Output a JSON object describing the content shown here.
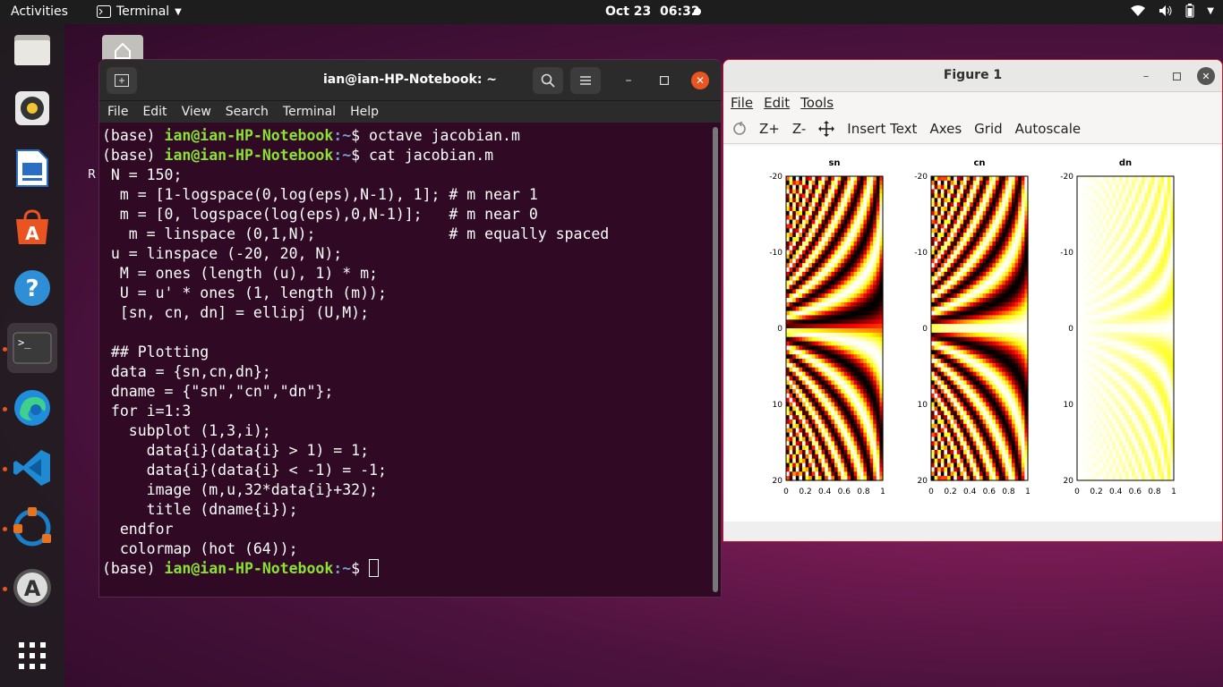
{
  "topbar": {
    "activities": "Activities",
    "app_name": "Terminal",
    "date": "Oct 23",
    "time": "06:32"
  },
  "desktop": {
    "label_fragment": "R"
  },
  "terminal": {
    "title": "ian@ian-HP-Notebook: ~",
    "menu": [
      "File",
      "Edit",
      "View",
      "Search",
      "Terminal",
      "Help"
    ],
    "prompt_env": "(base) ",
    "prompt_user": "ian@ian-HP-Notebook",
    "prompt_path": ":~",
    "prompt_sym": "$ ",
    "cmd1": "octave jacobian.m",
    "cmd2": "cat jacobian.m",
    "script_lines": [
      " N = 150;",
      "  m = [1-logspace(0,log(eps),N-1), 1]; # m near 1",
      "  m = [0, logspace(log(eps),0,N-1)];   # m near 0",
      "   m = linspace (0,1,N);               # m equally spaced",
      " u = linspace (-20, 20, N);",
      "  M = ones (length (u), 1) * m;",
      "  U = u' * ones (1, length (m));",
      "  [sn, cn, dn] = ellipj (U,M);",
      "",
      " ## Plotting",
      " data = {sn,cn,dn};",
      " dname = {\"sn\",\"cn\",\"dn\"};",
      " for i=1:3",
      "   subplot (1,3,i);",
      "     data{i}(data{i} > 1) = 1;",
      "     data{i}(data{i} < -1) = -1;",
      "     image (m,u,32*data{i}+32);",
      "     title (dname{i});",
      "  endfor",
      "  colormap (hot (64));"
    ]
  },
  "figure": {
    "title": "Figure 1",
    "menu": [
      "File",
      "Edit",
      "Tools"
    ],
    "toolbar": [
      "Z+",
      "Z-",
      "Insert Text",
      "Axes",
      "Grid",
      "Autoscale"
    ],
    "plots": [
      "sn",
      "cn",
      "dn"
    ],
    "y_ticks": [
      "-20",
      "-10",
      "0",
      "10",
      "20"
    ],
    "x_ticks": [
      "0",
      "0.2",
      "0.4",
      "0.6",
      "0.8",
      "1"
    ]
  },
  "chart_data": {
    "type": "heatmap",
    "panels": [
      {
        "title": "sn",
        "xlim": [
          0,
          1
        ],
        "ylim": [
          -20,
          20
        ],
        "colormap": "hot"
      },
      {
        "title": "cn",
        "xlim": [
          0,
          1
        ],
        "ylim": [
          -20,
          20
        ],
        "colormap": "hot"
      },
      {
        "title": "dn",
        "xlim": [
          0,
          1
        ],
        "ylim": [
          -20,
          20
        ],
        "colormap": "hot"
      }
    ],
    "x_ticks": [
      0,
      0.2,
      0.4,
      0.6,
      0.8,
      1
    ],
    "y_ticks": [
      -20,
      -10,
      0,
      10,
      20
    ]
  }
}
